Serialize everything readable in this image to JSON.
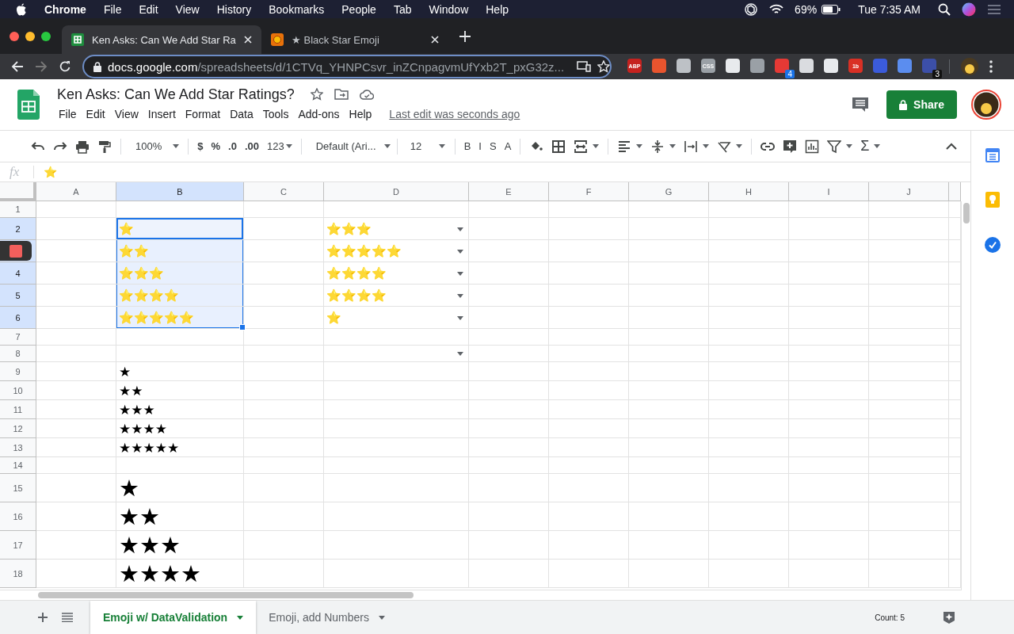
{
  "menubar": {
    "app": "Chrome",
    "menus": [
      "File",
      "Edit",
      "View",
      "History",
      "Bookmarks",
      "People",
      "Tab",
      "Window",
      "Help"
    ],
    "battery": "69%",
    "clock": "Tue 7:35 AM"
  },
  "browser": {
    "tabs": [
      {
        "title": "Ken Asks: Can We Add Star Ra",
        "selected": true,
        "kind": "sheets"
      },
      {
        "title": "★ Black Star Emoji",
        "selected": false,
        "kind": "web"
      }
    ],
    "url": {
      "host": "docs.google.com",
      "path": "/spreadsheets/d/1CTVq_YHNPCsvr_inZCnpagvmUfYxb2T_pxG32z..."
    },
    "extensions": [
      {
        "color": "#c5221f",
        "label": "ABP"
      },
      {
        "color": "#e8542e"
      },
      {
        "color": "#bdc1c6"
      },
      {
        "color": "#9aa0a6",
        "label": "CSS"
      },
      {
        "color": "#e8eaed"
      },
      {
        "color": "#9aa0a6"
      },
      {
        "color": "#e53935",
        "badge": "4"
      },
      {
        "color": "#dadce0"
      },
      {
        "color": "#e8eaed"
      },
      {
        "color": "#d93025",
        "label": "1b"
      },
      {
        "color": "#3b5bdb"
      },
      {
        "color": "#5b8def"
      },
      {
        "color": "#3c4fa8",
        "badge": "3"
      }
    ]
  },
  "document": {
    "title": "Ken Asks: Can We Add Star Ratings?",
    "menus": [
      "File",
      "Edit",
      "View",
      "Insert",
      "Format",
      "Data",
      "Tools",
      "Add-ons",
      "Help"
    ],
    "last_edit": "Last edit was seconds ago",
    "share": "Share"
  },
  "toolbar": {
    "zoom": "100%",
    "currency": "$",
    "percent": "%",
    "decrease_decimals": ".0",
    "increase_decimals": ".00",
    "number_format": "123",
    "font": "Default (Ari...",
    "font_size": "12",
    "bold": "B",
    "italic": "I",
    "strikethrough": "S",
    "text_color": "A",
    "functions": "Σ"
  },
  "formula_bar": {
    "label": "fx",
    "value": "⭐"
  },
  "grid": {
    "columns": [
      "A",
      "B",
      "C",
      "D",
      "E",
      "F",
      "G",
      "H",
      "I",
      "J"
    ],
    "rows": [
      {
        "label": "1"
      },
      {
        "label": "2",
        "cells": {
          "B": {
            "text": "⭐",
            "kind": "emoji",
            "selected": true,
            "active": true
          },
          "D": {
            "text": "⭐⭐⭐",
            "kind": "emoji",
            "selected": false,
            "active": false,
            "dropdown": true
          }
        }
      },
      {
        "cells": {
          "B": {
            "text": "⭐⭐",
            "kind": "emoji",
            "selected": true,
            "active": false
          },
          "D": {
            "text": "⭐⭐⭐⭐⭐",
            "kind": "emoji",
            "selected": false,
            "active": false,
            "dropdown": true
          }
        }
      },
      {
        "label": "4",
        "cells": {
          "B": {
            "text": "⭐⭐⭐",
            "kind": "emoji",
            "selected": true,
            "active": false
          },
          "D": {
            "text": "⭐⭐⭐⭐",
            "kind": "emoji",
            "selected": false,
            "active": false,
            "dropdown": true
          }
        }
      },
      {
        "label": "5",
        "cells": {
          "B": {
            "text": "⭐⭐⭐⭐",
            "kind": "emoji",
            "selected": true,
            "active": false
          },
          "D": {
            "text": "⭐⭐⭐⭐",
            "kind": "emoji",
            "selected": false,
            "active": false,
            "dropdown": true
          }
        }
      },
      {
        "label": "6",
        "cells": {
          "B": {
            "text": "⭐⭐⭐⭐⭐",
            "kind": "emoji",
            "selected": true,
            "active": false
          },
          "D": {
            "text": "⭐",
            "kind": "emoji",
            "selected": false,
            "active": false,
            "dropdown": true
          }
        }
      },
      {
        "label": "7"
      },
      {
        "label": "8",
        "cells": {
          "D": {
            "kind": "empty",
            "selected": false,
            "active": false,
            "dropdown": true
          }
        }
      },
      {
        "label": "9",
        "cells": {
          "B": {
            "text": "★",
            "kind": "star",
            "selected": false,
            "active": false
          }
        }
      },
      {
        "label": "10",
        "cells": {
          "B": {
            "text": "★★",
            "kind": "star",
            "selected": false,
            "active": false
          }
        }
      },
      {
        "label": "11",
        "cells": {
          "B": {
            "text": "★★★",
            "kind": "star",
            "selected": false,
            "active": false
          }
        }
      },
      {
        "label": "12",
        "cells": {
          "B": {
            "text": "★★★★",
            "kind": "star",
            "selected": false,
            "active": false
          }
        }
      },
      {
        "label": "13",
        "cells": {
          "B": {
            "text": "★★★★★",
            "kind": "star",
            "selected": false,
            "active": false
          }
        }
      },
      {
        "label": "14"
      },
      {
        "label": "15",
        "cells": {
          "B": {
            "text": "★",
            "kind": "large-star",
            "selected": false,
            "active": false
          }
        }
      },
      {
        "label": "16",
        "cells": {
          "B": {
            "text": "★★",
            "kind": "large-star",
            "selected": false,
            "active": false
          }
        }
      },
      {
        "label": "17",
        "cells": {
          "B": {
            "text": "★★★",
            "kind": "large-star",
            "selected": false,
            "active": false
          }
        }
      },
      {
        "label": "18",
        "cells": {
          "B": {
            "text": "★★★★",
            "kind": "large-star",
            "selected": false,
            "active": false
          }
        }
      }
    ]
  },
  "sheet_tabs": [
    {
      "label": "Emoji w/ DataValidation",
      "selected": true
    },
    {
      "label": "Emoji, add Numbers",
      "selected": false
    }
  ],
  "status": {
    "summary": "Count: 5"
  }
}
